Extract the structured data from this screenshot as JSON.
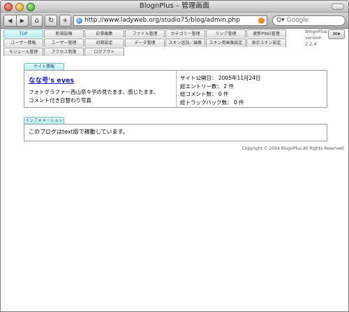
{
  "window": {
    "title": "BlognPlus – 管理画面"
  },
  "toolbar": {
    "back_label": "◀",
    "forward_label": "▶",
    "home_label": "⌂",
    "reload_label": "↻",
    "new_label": "+",
    "url": "http://www.ladyweb.org/studio75/blog/admin.php",
    "search_placeholder": "Google"
  },
  "nav": {
    "rows": [
      [
        {
          "label": "TOP",
          "active": true
        },
        {
          "label": "新規投稿"
        },
        {
          "label": "記事編集"
        },
        {
          "label": "ファイル管理"
        },
        {
          "label": "カテゴリー管理"
        },
        {
          "label": "リンク管理"
        },
        {
          "label": "更新PING管理"
        }
      ],
      [
        {
          "label": "ユーザー情報"
        },
        {
          "label": "ユーザー管理"
        },
        {
          "label": "初期設定"
        },
        {
          "label": "データ管理"
        },
        {
          "label": "スキン追加／編集"
        },
        {
          "label": "スキン用画像設定"
        },
        {
          "label": "表示スキン設定"
        }
      ],
      [
        {
          "label": "モジュール管理"
        },
        {
          "label": "アクセス制限"
        },
        {
          "label": "ログアウト"
        }
      ]
    ],
    "version_line1": "BlognPlus",
    "version_line2": "version",
    "version_line3": "2.2.4",
    "mail_label": "✉▾"
  },
  "site": {
    "header": "サイト情報",
    "blog_title": "なな号's eyes",
    "desc_line1": "フォトグラファー西山奈々子の見たまま、感じたまま、",
    "desc_line2": "コメント付き日替わり写真",
    "stat1": "サイト公開日： 2005年11月24日",
    "stat2": "総エントリー数： 2 件",
    "stat3": "総コメント数： 0 件",
    "stat4": "総トラックバック数： 0 件"
  },
  "info": {
    "header": "インフォメーション",
    "text": "このブログはtext版で稼動しています。"
  },
  "footer": {
    "copyright": "Copyright © 2004 BlognPlus All Rights Reserved."
  }
}
